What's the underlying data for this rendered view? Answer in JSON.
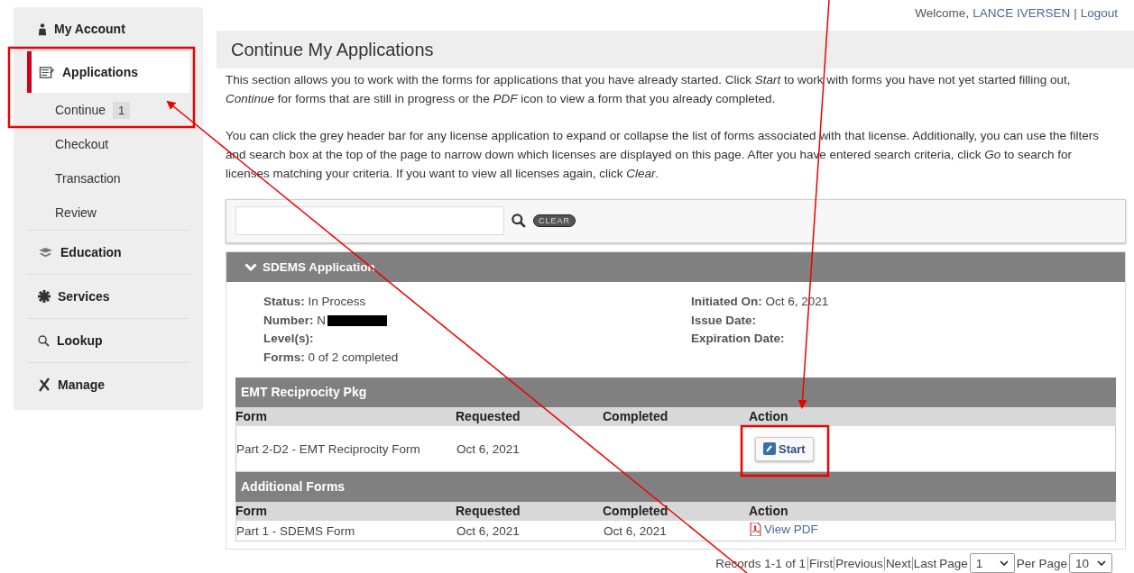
{
  "header": {
    "welcome": "Welcome,",
    "user": "LANCE IVERSEN",
    "separator": "|",
    "logout": "Logout"
  },
  "sidebar": {
    "items": [
      {
        "label": "My Account",
        "kind": "person",
        "selected": false
      },
      {
        "label": "Applications",
        "kind": "form",
        "selected": true,
        "children": [
          {
            "label": "Continue",
            "badge": "1",
            "selected": false
          },
          {
            "label": "Checkout",
            "selected": false
          },
          {
            "label": "Transaction",
            "selected": false
          },
          {
            "label": "Review",
            "selected": false
          }
        ]
      },
      {
        "label": "Education",
        "kind": "cap",
        "selected": false
      },
      {
        "label": "Services",
        "kind": "asterisk",
        "selected": false
      },
      {
        "label": "Lookup",
        "kind": "search",
        "selected": false
      },
      {
        "label": "Manage",
        "kind": "tools",
        "selected": false
      }
    ]
  },
  "page_title": "Continue My Applications",
  "intro": [
    "This section allows you to work with the forms for applications that you have already started. Click *Start* to work with forms you have not yet started filling out, *Continue* for forms that are still in progress or the *PDF* icon to view a form that you already completed.",
    "You can click the grey header bar for any license application to expand or collapse the list of forms associated with that license. Additionally, you can use the filters and search box at the top of the page to narrow down which licenses are displayed on this page. After you have entered search criteria, click *Go* to search for licenses matching your criteria. If you want to view all licenses again, click *Clear*."
  ],
  "search": {
    "clear_label": "CLEAR"
  },
  "application": {
    "title": "SDEMS Application",
    "expanded": true,
    "details_left": [
      {
        "label": "Status:",
        "value": "In Process"
      },
      {
        "label": "Number:",
        "value": "N",
        "redacted": true
      },
      {
        "label": "Level(s):"
      },
      {
        "label": "Forms:",
        "value": "0 of 2 completed"
      }
    ],
    "details_right": [
      {
        "label": "Initiated On:",
        "value": "Oct 6, 2021"
      },
      {
        "label": "Issue Date:"
      },
      {
        "label": "Expiration Date:"
      }
    ],
    "sections": [
      {
        "title": "EMT Reciprocity Pkg",
        "columns": [
          "Form",
          "Requested",
          "Completed",
          "Action"
        ],
        "rows": [
          {
            "form": "Part 2-D2 - EMT Reciprocity Form",
            "requested": "Oct 6, 2021",
            "action": {
              "kind": "button",
              "label": "Start"
            }
          }
        ]
      },
      {
        "title": "Additional Forms",
        "columns": [
          "Form",
          "Requested",
          "Completed",
          "Action"
        ],
        "rows": [
          {
            "form": "Part 1 - SDEMS Form",
            "requested": "Oct 6, 2021",
            "completed": "Oct 6, 2021",
            "action": {
              "kind": "link",
              "label": "View PDF"
            }
          }
        ]
      }
    ]
  },
  "pager": {
    "records": "Records 1-1 of 1",
    "links": [
      "First",
      "Previous",
      "Next",
      "Last"
    ],
    "page_label": "Page",
    "page": "1",
    "per_page_label": "Per Page",
    "per_page": "10"
  }
}
